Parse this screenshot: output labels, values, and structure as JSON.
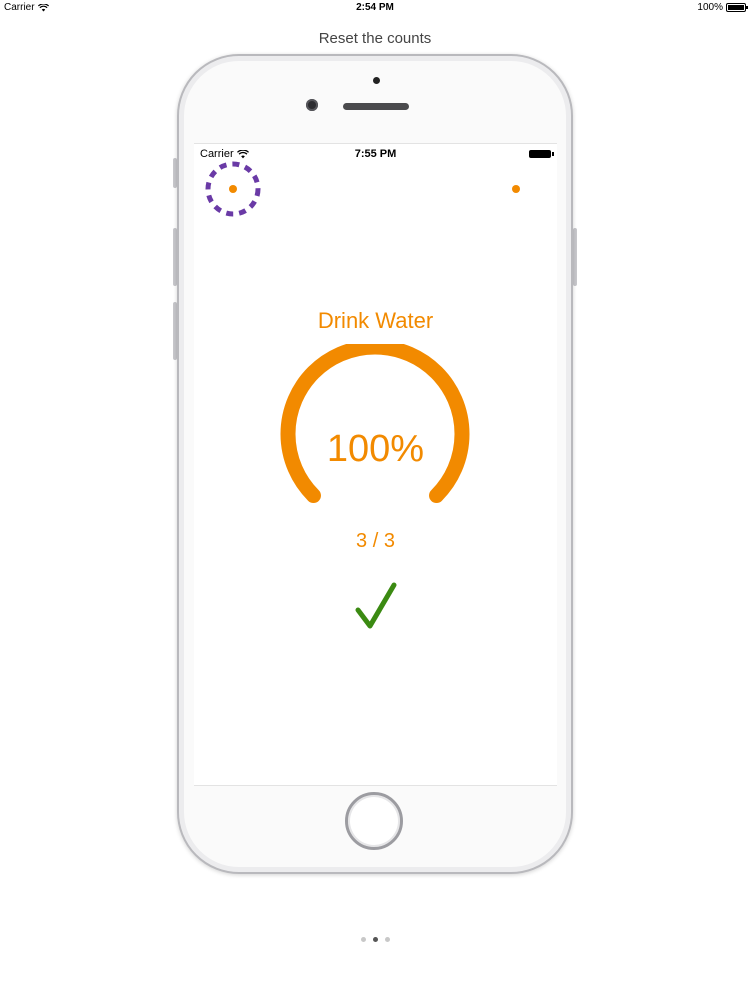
{
  "device_status": {
    "carrier": "Carrier",
    "time": "2:54 PM",
    "battery": "100%"
  },
  "caption": "Reset the counts",
  "phone_status": {
    "carrier": "Carrier",
    "time": "7:55 PM"
  },
  "habit": {
    "title": "Drink Water",
    "percent": "100%",
    "count": "3 / 3",
    "progress": 1.0,
    "completed": true
  },
  "colors": {
    "accent": "#f28a00",
    "menu_ring": "#6a3aa6",
    "check": "#3b8a12"
  },
  "pager": {
    "pages": 3,
    "current": 1
  }
}
